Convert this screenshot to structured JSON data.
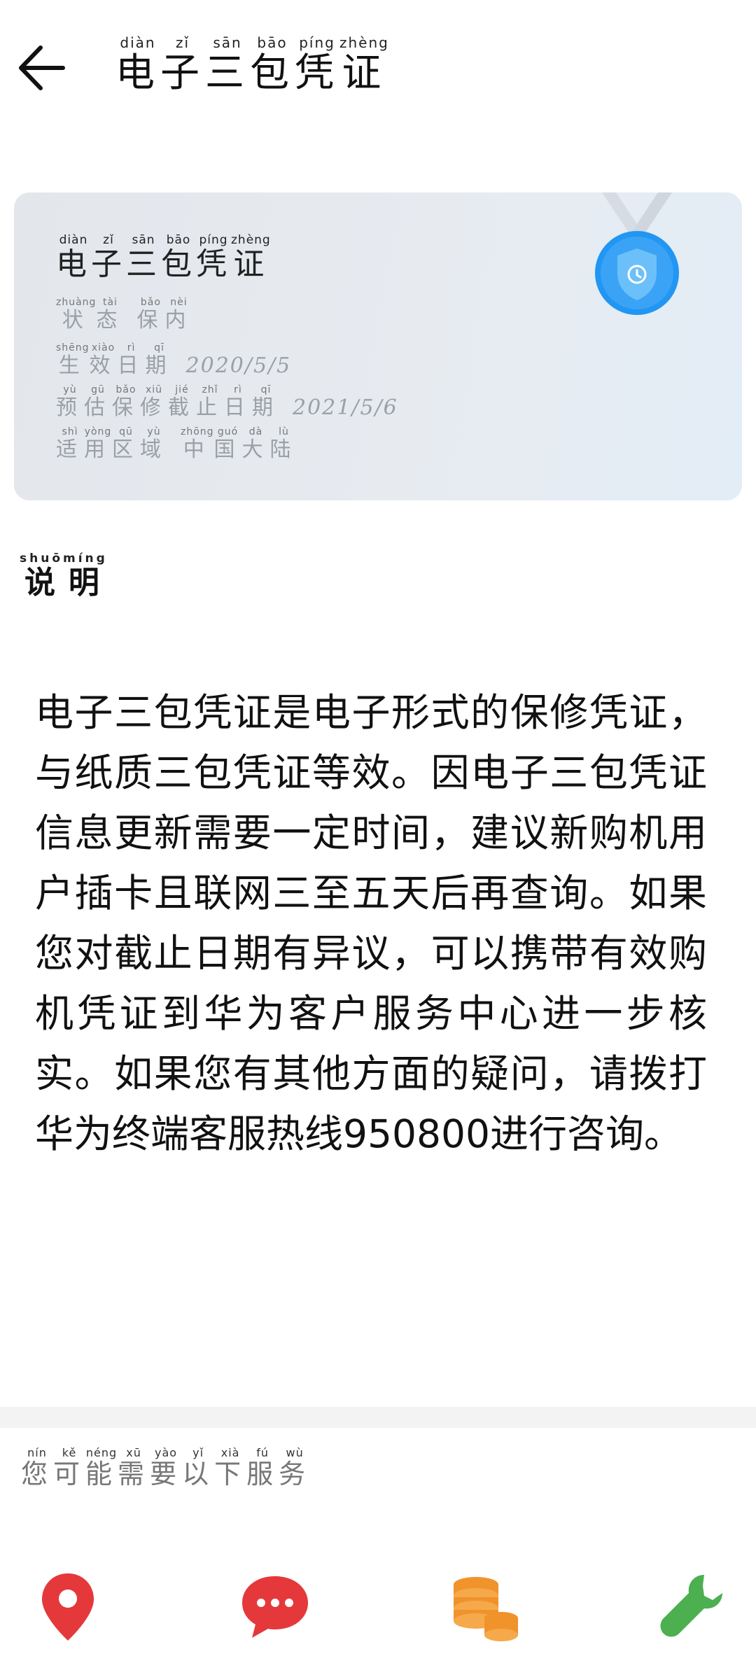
{
  "header": {
    "title_chars": [
      {
        "han": "电",
        "py": "diàn"
      },
      {
        "han": "子",
        "py": "zǐ"
      },
      {
        "han": "三",
        "py": "sān"
      },
      {
        "han": "包",
        "py": "bāo"
      },
      {
        "han": "凭",
        "py": "píng"
      },
      {
        "han": "证",
        "py": "zhèng"
      }
    ]
  },
  "card": {
    "title_chars": [
      {
        "han": "电",
        "py": "diàn"
      },
      {
        "han": "子",
        "py": "zǐ"
      },
      {
        "han": "三",
        "py": "sān"
      },
      {
        "han": "包",
        "py": "bāo"
      },
      {
        "han": "凭",
        "py": "píng"
      },
      {
        "han": "证",
        "py": "zhèng"
      }
    ],
    "rows": [
      {
        "label": [
          {
            "han": "状",
            "py": "zhuàng"
          },
          {
            "han": "态",
            "py": "tài"
          }
        ],
        "value_chars": [
          {
            "han": "保",
            "py": "bǎo"
          },
          {
            "han": "内",
            "py": "nèi"
          }
        ]
      },
      {
        "label": [
          {
            "han": "生",
            "py": "shēng"
          },
          {
            "han": "效",
            "py": "xiào"
          },
          {
            "han": "日",
            "py": "rì"
          },
          {
            "han": "期",
            "py": "qī"
          }
        ],
        "value": "2020/5/5"
      },
      {
        "label": [
          {
            "han": "预",
            "py": "yù"
          },
          {
            "han": "估",
            "py": "gū"
          },
          {
            "han": "保",
            "py": "bǎo"
          },
          {
            "han": "修",
            "py": "xiū"
          },
          {
            "han": "截",
            "py": "jié"
          },
          {
            "han": "止",
            "py": "zhǐ"
          },
          {
            "han": "日",
            "py": "rì"
          },
          {
            "han": "期",
            "py": "qī"
          }
        ],
        "value": "2021/5/6"
      },
      {
        "label": [
          {
            "han": "适",
            "py": "shì"
          },
          {
            "han": "用",
            "py": "yòng"
          },
          {
            "han": "区",
            "py": "qū"
          },
          {
            "han": "域",
            "py": "yù"
          }
        ],
        "value_chars": [
          {
            "han": "中",
            "py": "zhōng"
          },
          {
            "han": "国",
            "py": "guó"
          },
          {
            "han": "大",
            "py": "dà"
          },
          {
            "han": "陆",
            "py": "lù"
          }
        ]
      }
    ]
  },
  "explanation": {
    "title_chars": [
      {
        "han": "说",
        "py": "shuō"
      },
      {
        "han": "明",
        "py": "míng"
      }
    ],
    "body": "电子三包凭证是电子形式的保修凭证，与纸质三包凭证等效。因电子三包凭证信息更新需要一定时间，建议新购机用户插卡且联网三至五天后再查询。如果您对截止日期有异议，可以携带有效购机凭证到华为客户服务中心进一步核实。如果您有其他方面的疑问，请拨打华为终端客服热线950800进行咨询。"
  },
  "services": {
    "title_chars": [
      {
        "han": "您",
        "py": "nín"
      },
      {
        "han": "可",
        "py": "kě"
      },
      {
        "han": "能",
        "py": "néng"
      },
      {
        "han": "需",
        "py": "xū"
      },
      {
        "han": "要",
        "py": "yào"
      },
      {
        "han": "以",
        "py": "yǐ"
      },
      {
        "han": "下",
        "py": "xià"
      },
      {
        "han": "服",
        "py": "fú"
      },
      {
        "han": "务",
        "py": "wù"
      }
    ],
    "icons": [
      {
        "icon": "location-pin-icon",
        "color": "#e5383b"
      },
      {
        "icon": "chat-bubble-icon",
        "color": "#e5383b"
      },
      {
        "icon": "coin-stack-icon",
        "color": "#f0932b"
      },
      {
        "icon": "wrench-icon",
        "color": "#4caf50"
      }
    ]
  },
  "colors": {
    "badge_blue": "#2196f3",
    "card_bg": "#e5e9ee"
  }
}
